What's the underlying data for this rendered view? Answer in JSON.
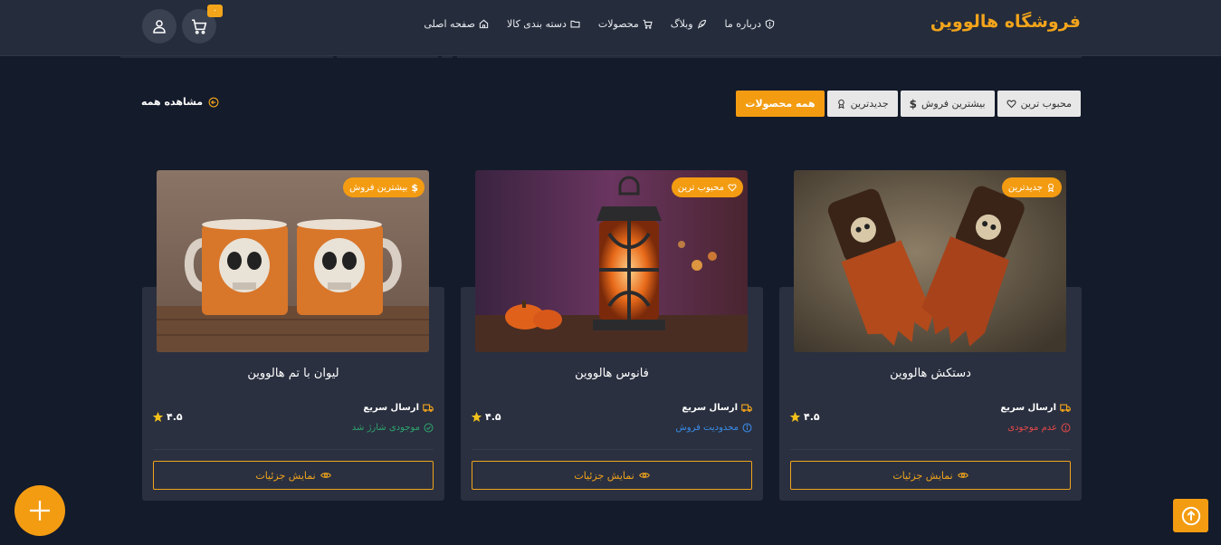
{
  "header": {
    "logo": "فروشگاه هالووین",
    "cart_count": "۰",
    "nav": [
      {
        "label": "صفحه اصلی",
        "icon": "home-icon"
      },
      {
        "label": "دسته بندی کالا",
        "icon": "folder-icon"
      },
      {
        "label": "محصولات",
        "icon": "cart-icon"
      },
      {
        "label": "وبلاگ",
        "icon": "feather-icon"
      },
      {
        "label": "درباره ما",
        "icon": "shield-icon"
      }
    ]
  },
  "filters": {
    "all": "همه محصولات",
    "newest": "جدیدترین",
    "bestselling": "بیشترین فروش",
    "popular": "محبوب ترین"
  },
  "view_all": "مشاهده همه",
  "products": [
    {
      "title": "دستکش هالووین",
      "tag": "جدیدترین",
      "shipping": "ارسال سریع",
      "stock": "عدم موجودی",
      "stock_color": "#e04848",
      "rating": "۴.۵",
      "button": "نمایش جزئیات"
    },
    {
      "title": "فانوس هالووین",
      "tag": "محبوب ترین",
      "shipping": "ارسال سریع",
      "stock": "محدودیت فروش",
      "stock_color": "#3a8eea",
      "rating": "۴.۵",
      "button": "نمایش جزئیات"
    },
    {
      "title": "لیوان با تم هالووین",
      "tag": "بیشترین فروش",
      "shipping": "ارسال سریع",
      "stock": "موجودی شارژ شد",
      "stock_color": "#2fa36b",
      "rating": "۴.۵",
      "button": "نمایش جزئیات"
    }
  ],
  "colors": {
    "accent": "#f39c12",
    "background": "#141b2b",
    "card": "#2a3040"
  }
}
